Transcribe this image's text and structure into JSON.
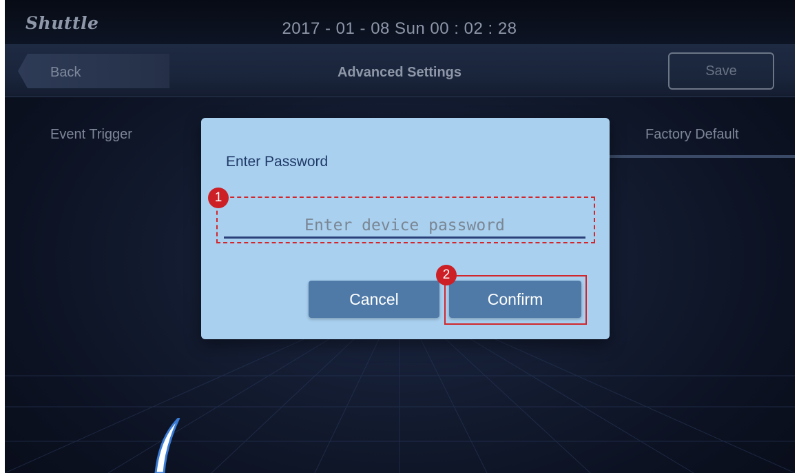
{
  "topbar": {
    "brand": "Shuttle",
    "datetime": "2017 - 01 - 08   Sun   00 : 02 : 28"
  },
  "navbar": {
    "back_label": "Back",
    "title": "Advanced Settings",
    "save_label": "Save"
  },
  "tabs": [
    {
      "label": "Event Trigger"
    },
    {
      "label": "Factory Default"
    }
  ],
  "dialog": {
    "title": "Enter Password",
    "input_placeholder": "Enter device password",
    "cancel_label": "Cancel",
    "confirm_label": "Confirm"
  },
  "annotations": [
    {
      "step": "1"
    },
    {
      "step": "2"
    }
  ],
  "colors": {
    "dialog_bg": "#a9d0ef",
    "button_blue": "#4f7aa8",
    "highlight_red": "#d1262c"
  }
}
